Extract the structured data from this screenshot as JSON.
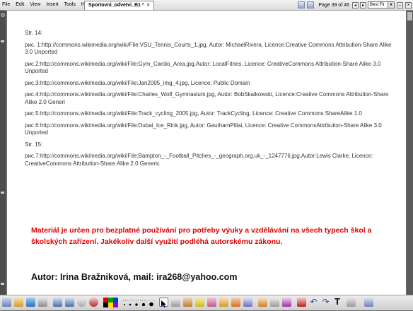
{
  "menu": [
    "File",
    "Edit",
    "View",
    "Insert",
    "Tools",
    "Help"
  ],
  "tab": {
    "title": "Sportovni_odvetvi_B1",
    "modified_mark": "*",
    "close_glyph": "×"
  },
  "nav": {
    "page_indicator": "Page 39 of 46",
    "prev_glyph": "◂",
    "next_glyph": "▸",
    "zoom_value": "Best Fit",
    "minimize_glyph": "–",
    "close_glyph": "×"
  },
  "content": {
    "refs": [
      "Str. 14:",
      "рис. 1:http://commons.wikimedia.org/wiki/File:VSU_Tennis_Courts_1.jpg, Autor: MichaelRivera, Licence:Creative Commons Attribution-Share Alike 3.0 Unported",
      "рис.2:http://commons.wikimedia.org/wiki/File:Gym_Cardio_Area.jpg,Autor: LocalFitnes,  Licence: CreativeCommons Attribution-Share Alike 3.0 Unported",
      "рис.3:http://commons.wikimedia.org/wiki/File:Jan2005_img_4.jpg, Licence: Public Domain",
      "рис.4:http://commons.wikimedia.org/wiki/File:Charles_Wolf_Gymnasium.jpg, Autor: BobSkalkowski, Licence:Creative Commons Attribution-Share Alike 2.0 Generi",
      "рис.5:http://commons.wikimedia.org/wiki/File:Track_cycling_2005.jpg, Autor: TrackCycling, Licence: Creative Commons ShareAlike 1.0",
      "рис.6:http://commons.wikimedia.org/wiki/File:Dubai_Ice_Rink.jpg, Autor: GauthamPillai,  Licence: Creative CommonsAttribution-Share Alike 3.0 Unported",
      "Str. 15:",
      "рис.7:http://commons.wikimedia.org/wiki/File:Bampton_-_Football_Pitches_-_geograph.org.uk_-_1247776.jpg,Autor:Lewis Clarke, Licence:  CreativeCommons Attribution-Share Alike 2.0 Generic"
    ],
    "notice": "Materiál je určen pro bezplatné používání pro potřeby výuky a vzdělávání na všech typech škol a školských zařízení. Jakékoliv další využití podléhá autorskému zákonu.",
    "author": "Autor: Irina Bražniková, mail: ira268@yahoo.com"
  },
  "toolbar": {
    "text_tool_glyph": "T",
    "icons": [
      "page-sorter",
      "gallery",
      "attachments",
      "properties",
      "prev-page",
      "next-page",
      "screen-shade",
      "record",
      "color-palette",
      "line-width",
      "select",
      "magic-pen",
      "pen",
      "highlighter",
      "eraser",
      "shape",
      "fill",
      "line",
      "table",
      "undo",
      "redo",
      "delete",
      "text",
      "more"
    ]
  },
  "colors": {
    "notice": "#e00000",
    "page_bg": "#ffffff",
    "frame": "#6b6b6b"
  }
}
